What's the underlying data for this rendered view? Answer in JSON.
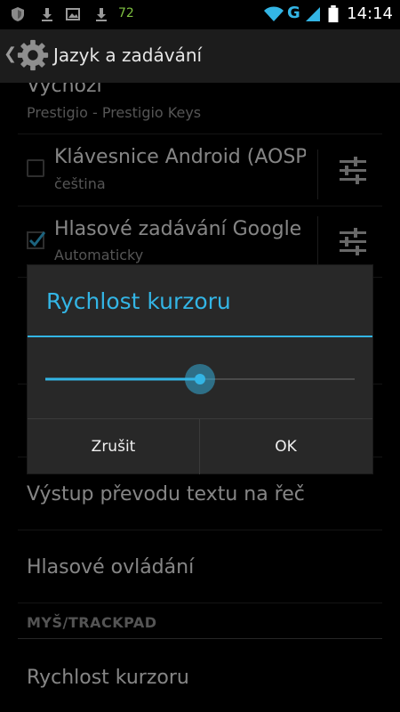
{
  "status_bar": {
    "notification_count": "72",
    "network_type": "G",
    "time": "14:14"
  },
  "action_bar": {
    "title": "Jazyk a zadávání"
  },
  "list": {
    "default_item": {
      "title": "Výchozí",
      "subtitle": "Prestigio - Prestigio Keys"
    },
    "keyboard_android": {
      "title": "Klávesnice Android (AOSP)",
      "subtitle": "čeština",
      "checked": false
    },
    "voice_input": {
      "title": "Hlasové zadávání Google",
      "subtitle": "Automaticky",
      "checked": true
    },
    "tts_output": {
      "title": "Výstup převodu textu na řeč"
    },
    "voice_control": {
      "title": "Hlasové ovládání"
    },
    "section_mouse": "MYŠ/TRACKPAD",
    "cursor_speed": {
      "title": "Rychlost kurzoru"
    }
  },
  "dialog": {
    "title": "Rychlost kurzoru",
    "slider_value": 0.5,
    "cancel_label": "Zrušit",
    "ok_label": "OK"
  },
  "colors": {
    "accent": "#33b5e5",
    "background": "#000000",
    "dialog_bg": "#282828"
  }
}
